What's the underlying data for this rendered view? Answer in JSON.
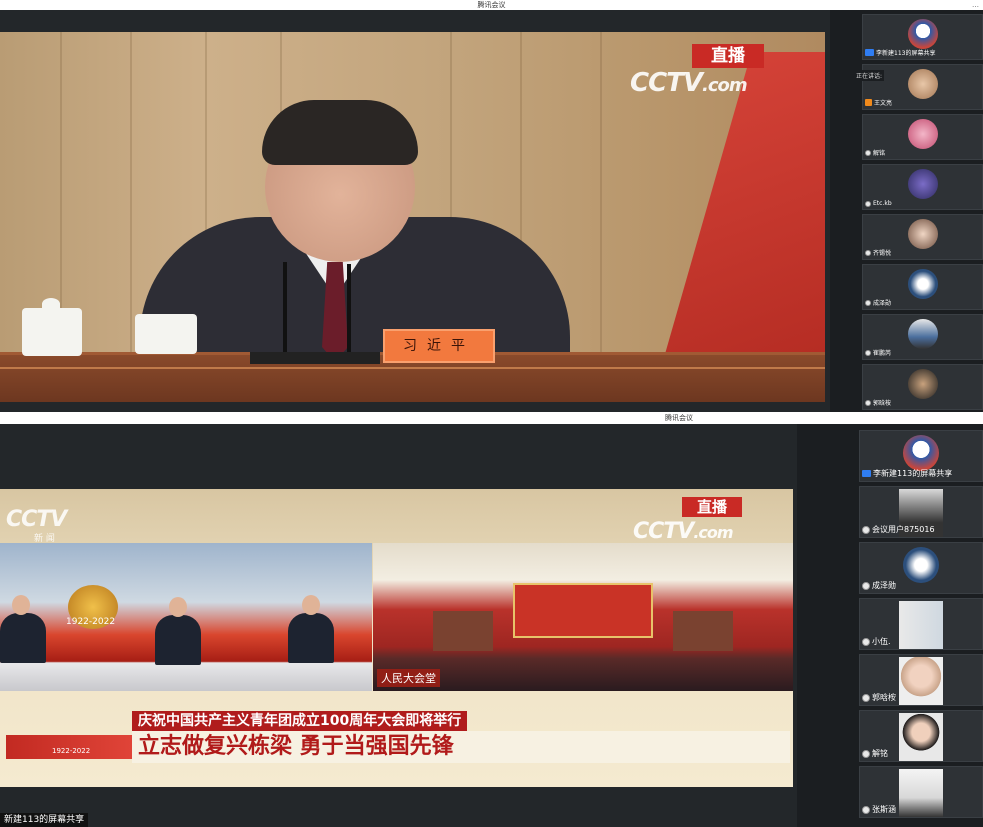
{
  "window1": {
    "title": "腾讯会议",
    "live_badge": "直播",
    "cctv_logo": "CCTV",
    "cctv_suffix": ".com",
    "nameplate": "习近平",
    "speaking_label": "正在讲话:",
    "participants": [
      {
        "name": "李新建113的屏幕共享",
        "role": "share"
      },
      {
        "name": "王文亮",
        "role": "host"
      },
      {
        "name": "解铭",
        "role": "member"
      },
      {
        "name": "Etc.kb",
        "role": "member"
      },
      {
        "name": "齐锡悦",
        "role": "member"
      },
      {
        "name": "成泽勋",
        "role": "member"
      },
      {
        "name": "崔鹏芮",
        "role": "member"
      },
      {
        "name": "郭晗桉",
        "role": "member"
      }
    ]
  },
  "window2": {
    "title": "腾讯会议",
    "live_badge": "直播",
    "cctv_logo": "CCTV",
    "cctv_suffix": ".com",
    "top_logo": "CCTV",
    "top_logo_sub": "新 闻",
    "emblem_years": "1922-2022",
    "hall_label": "人民大会堂",
    "headline_top": "庆祝中国共产主义青年团成立100周年大会即将举行",
    "headline_main": "立志做复兴栋梁  勇于当强国先锋",
    "headline_logo_years": "1922-2022",
    "footer_label": "新建113的屏幕共享",
    "participants": [
      {
        "name": "李新建113的屏幕共享",
        "role": "share"
      },
      {
        "name": "会议用户875016",
        "role": "member"
      },
      {
        "name": "成泽勋",
        "role": "member"
      },
      {
        "name": "小伍.",
        "role": "member"
      },
      {
        "name": "郭晗桉",
        "role": "member"
      },
      {
        "name": "解铭",
        "role": "member"
      },
      {
        "name": "张斯涵",
        "role": "member"
      }
    ]
  }
}
